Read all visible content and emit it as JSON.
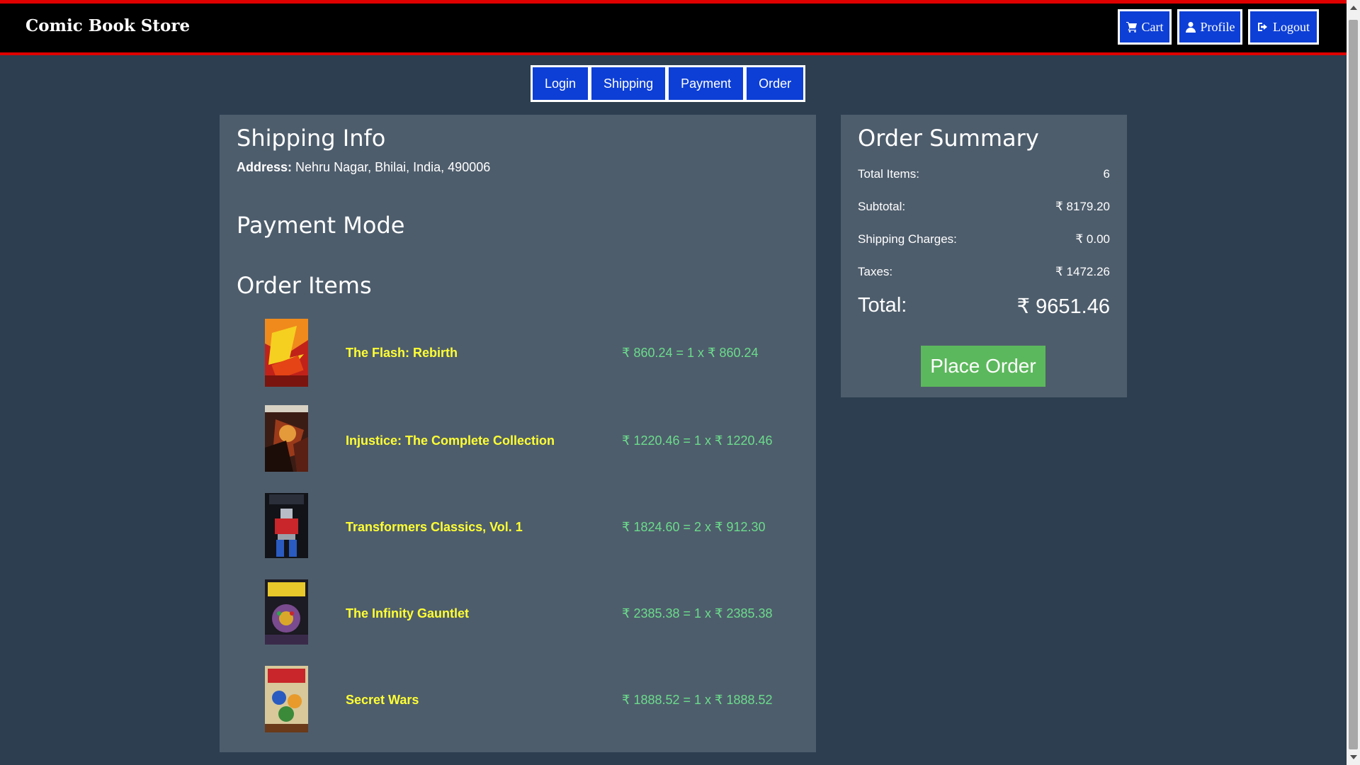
{
  "navbar": {
    "brand": "Comic Book Store",
    "buttons": [
      {
        "label": "Cart",
        "icon": "cart-icon"
      },
      {
        "label": "Profile",
        "icon": "user-icon"
      },
      {
        "label": "Logout",
        "icon": "logout-icon"
      }
    ]
  },
  "steps": [
    "Login",
    "Shipping",
    "Payment",
    "Order"
  ],
  "shipping": {
    "title": "Shipping Info",
    "address_label": "Address:",
    "address": "Nehru Nagar, Bhilai, India, 490006"
  },
  "payment": {
    "title": "Payment Mode"
  },
  "order_items": {
    "title": "Order Items",
    "items": [
      {
        "name": "The Flash: Rebirth",
        "price": "₹ 860.24 = 1 x ₹ 860.24"
      },
      {
        "name": "Injustice: The Complete Collection",
        "price": "₹ 1220.46 = 1 x ₹ 1220.46"
      },
      {
        "name": "Transformers Classics, Vol. 1",
        "price": "₹ 1824.60 = 2 x ₹ 912.30"
      },
      {
        "name": "The Infinity Gauntlet",
        "price": "₹ 2385.38 = 1 x ₹ 2385.38"
      },
      {
        "name": "Secret Wars",
        "price": "₹ 1888.52 = 1 x ₹ 1888.52"
      }
    ]
  },
  "summary": {
    "title": "Order Summary",
    "rows": [
      {
        "label": "Total Items:",
        "value": "6"
      },
      {
        "label": "Subtotal:",
        "value": "₹ 8179.20"
      },
      {
        "label": "Shipping Charges:",
        "value": "₹ 0.00"
      },
      {
        "label": "Taxes:",
        "value": "₹ 1472.26"
      }
    ],
    "total_label": "Total:",
    "total_value": "₹ 9651.46",
    "place_order_label": "Place Order"
  },
  "colors": {
    "background": "#2c3e50",
    "card": "#4e5d6c",
    "accent_red": "#e00000",
    "button_blue": "#0d3fd6",
    "item_name": "#ffff33",
    "item_price": "#6bdc8b",
    "place_order": "#5cb85c"
  }
}
